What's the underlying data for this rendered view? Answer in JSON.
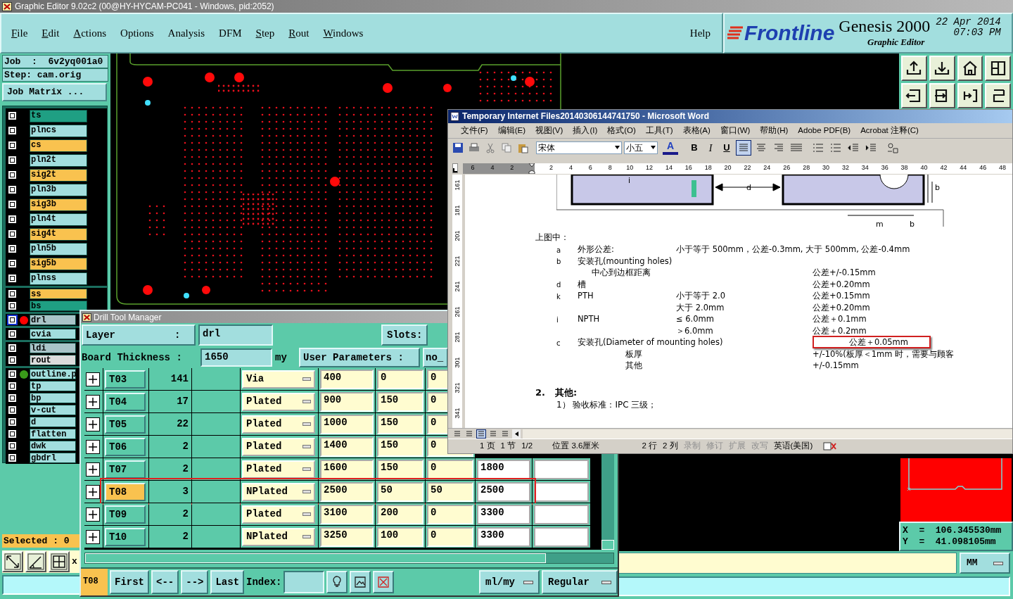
{
  "window": {
    "title": "Graphic Editor 9.02c2 (00@HY-HYCAM-PC041 - Windows, pid:2052)"
  },
  "menu": [
    {
      "label": "File",
      "mnemonic": true
    },
    {
      "label": "Edit",
      "mnemonic": true
    },
    {
      "label": "Actions",
      "mnemonic": true
    },
    {
      "label": "Options",
      "mnemonic": false
    },
    {
      "label": "Analysis",
      "mnemonic": false
    },
    {
      "label": "DFM",
      "mnemonic": false
    },
    {
      "label": "Step",
      "mnemonic": true
    },
    {
      "label": "Rout",
      "mnemonic": true
    },
    {
      "label": "Windows",
      "mnemonic": true
    }
  ],
  "help": "Help",
  "brand": {
    "logo": "Frontline",
    "product": "Genesis 2000",
    "date": "22 Apr 2014",
    "time": "07:03 PM",
    "subtitle": "Graphic Editor"
  },
  "job": {
    "job": "Job  :  6v2yq001a0",
    "step": "Step: cam.orig",
    "matrix_button": "Job Matrix ..."
  },
  "layer_groups": [
    {
      "kind": "spaced",
      "layers": [
        {
          "name": "ts",
          "color": "#1f9f83",
          "active": false
        },
        {
          "name": "plncs",
          "color": "#a2dede",
          "active": false
        },
        {
          "name": "cs",
          "color": "#f9c24f",
          "active": false
        },
        {
          "name": "pln2t",
          "color": "#a2dede",
          "active": false
        },
        {
          "name": "sig2t",
          "color": "#f9c24f",
          "active": false
        },
        {
          "name": "pln3b",
          "color": "#a2dede",
          "active": false
        },
        {
          "name": "sig3b",
          "color": "#f9c24f",
          "active": false
        },
        {
          "name": "pln4t",
          "color": "#a2dede",
          "active": false
        },
        {
          "name": "sig4t",
          "color": "#f9c24f",
          "active": false
        },
        {
          "name": "pln5b",
          "color": "#a2dede",
          "active": false
        },
        {
          "name": "sig5b",
          "color": "#f9c24f",
          "active": false
        },
        {
          "name": "plnss",
          "color": "#a2dede",
          "active": false
        }
      ]
    },
    {
      "kind": "compact",
      "layers": [
        {
          "name": "ss",
          "color": "#f9c24f",
          "active": false
        },
        {
          "name": "bs",
          "color": "#1f9f83",
          "active": false
        }
      ]
    },
    {
      "kind": "compact",
      "layers": [
        {
          "name": "drl",
          "color": "#a9c4c8",
          "active": true,
          "marker": {
            "color": "#ff0000"
          }
        }
      ]
    },
    {
      "kind": "compact",
      "layers": [
        {
          "name": "cvia",
          "color": "#a2dede",
          "active": false
        }
      ]
    },
    {
      "kind": "compact",
      "layers": [
        {
          "name": "ldi",
          "color": "#a9c4c8",
          "active": false
        },
        {
          "name": "rout",
          "color": "#dcdcdc",
          "active": false
        }
      ]
    },
    {
      "kind": "compact",
      "layers": [
        {
          "name": "outline.p",
          "color": "#a2dede",
          "active": false,
          "marker": {
            "color": "#3a9a1a"
          }
        },
        {
          "name": "tp",
          "color": "#a2dede",
          "active": false
        },
        {
          "name": "bp",
          "color": "#a2dede",
          "active": false
        },
        {
          "name": "v-cut",
          "color": "#a2dede",
          "active": false
        },
        {
          "name": "d",
          "color": "#a2dede",
          "active": false
        },
        {
          "name": "flatten",
          "color": "#a2dede",
          "active": false
        },
        {
          "name": "dwk",
          "color": "#a2dede",
          "active": false
        },
        {
          "name": "gbdrl",
          "color": "#a2dede",
          "active": false
        }
      ]
    }
  ],
  "selected_count": "Selected : 0",
  "x_label": "x",
  "coordinates": {
    "x": "X  =  106.345530mm",
    "y": "Y  =  41.098105mm"
  },
  "units": "MM",
  "drill_manager": {
    "title": "Drill Tool Manager",
    "layer_label": "Layer          :",
    "layer": "drl",
    "slots_label": "Slots:",
    "thickness_label": "Board Thickness :",
    "thickness": "1650",
    "thickness_unit": "my",
    "user_params_label": "User Parameters :",
    "user_params": "no_",
    "rows": [
      {
        "tool": "T03",
        "count": "141",
        "type": "Via",
        "finish": "400",
        "plus": "0",
        "minus": "0",
        "selected": false,
        "highlighted": false
      },
      {
        "tool": "T04",
        "count": "17",
        "type": "Plated",
        "finish": "900",
        "plus": "150",
        "minus": "0",
        "selected": false,
        "highlighted": false
      },
      {
        "tool": "T05",
        "count": "22",
        "type": "Plated",
        "finish": "1000",
        "plus": "150",
        "minus": "0",
        "selected": false,
        "highlighted": false
      },
      {
        "tool": "T06",
        "count": "2",
        "type": "Plated",
        "finish": "1400",
        "plus": "150",
        "minus": "0",
        "selected": false,
        "highlighted": false
      },
      {
        "tool": "T07",
        "count": "2",
        "type": "Plated",
        "finish": "1600",
        "plus": "150",
        "minus": "0",
        "drill": "1800",
        "selected": false,
        "highlighted": false
      },
      {
        "tool": "T08",
        "count": "3",
        "type": "NPlated",
        "finish": "2500",
        "plus": "50",
        "minus": "50",
        "drill": "2500",
        "selected": true,
        "highlighted": true
      },
      {
        "tool": "T09",
        "count": "2",
        "type": "Plated",
        "finish": "3100",
        "plus": "200",
        "minus": "0",
        "drill": "3300",
        "selected": false,
        "highlighted": false
      },
      {
        "tool": "T10",
        "count": "2",
        "type": "NPlated",
        "finish": "3250",
        "plus": "100",
        "minus": "0",
        "drill": "3300",
        "selected": false,
        "highlighted": false
      }
    ],
    "current": "T08",
    "nav": [
      "First",
      "<--",
      "-->",
      "Last"
    ],
    "index_label": "Index:",
    "units": "ml/my",
    "mode": "Regular"
  },
  "word": {
    "title": "Temporary Internet Files20140306144741750 - Microsoft Word",
    "menu": [
      "文件(F)",
      "编辑(E)",
      "视图(V)",
      "插入(I)",
      "格式(O)",
      "工具(T)",
      "表格(A)",
      "窗口(W)",
      "帮助(H)",
      "Adobe PDF(B)",
      "Acrobat 注释(C)"
    ],
    "font": "宋体",
    "size": "小五",
    "font_color": "A",
    "bold": "B",
    "italic": "I",
    "underline": "U",
    "ruler": [
      "6",
      "4",
      "2",
      "2",
      "4",
      "6",
      "8",
      "10",
      "12",
      "14",
      "16",
      "18",
      "20",
      "22",
      "24",
      "26",
      "28",
      "30",
      "32",
      "34",
      "36",
      "38",
      "40",
      "42",
      "44",
      "46",
      "48"
    ],
    "vruler": [
      "161",
      "181",
      "201",
      "221",
      "241",
      "261",
      "281",
      "301",
      "321",
      "341"
    ],
    "diagram_labels": [
      "i",
      "d",
      "b",
      "m",
      "b"
    ],
    "heading": "上图中：",
    "lines": [
      {
        "kind": "main",
        "mark": "a",
        "item": "外形公差:",
        "condition": "小于等于 500mm，公差-0.3mm, 大于 500mm, 公差-0.4mm",
        "highlighted": false
      },
      {
        "kind": "main",
        "mark": "b",
        "item": "安装孔(mounting holes)",
        "highlighted": false
      },
      {
        "kind": "sub",
        "item": "中心到边框距离",
        "tolerance": "公差+/-0.15mm",
        "highlighted": false
      },
      {
        "kind": "main",
        "mark": "d",
        "item": "槽",
        "tolerance": "公差+0.20mm",
        "highlighted": false
      },
      {
        "kind": "main",
        "mark": "k",
        "item": "PTH",
        "condition": "小于等于 2.0",
        "tolerance": "公差+0.15mm",
        "highlighted": false
      },
      {
        "kind": "sub",
        "condition": "大于 2.0mm",
        "tolerance": "公差+0.20mm",
        "highlighted": false
      },
      {
        "kind": "main",
        "mark": "i",
        "item": "NPTH",
        "condition": "≤ 6.0mm",
        "tolerance": "公差＋0.1mm",
        "highlighted": false
      },
      {
        "kind": "sub",
        "condition": "＞6.0mm",
        "tolerance": "公差＋0.2mm",
        "highlighted": false
      },
      {
        "kind": "main",
        "mark": "c",
        "item": "安装孔(Diameter of mounting holes)",
        "tolerance": "公差＋0.05mm",
        "highlighted": true
      },
      {
        "kind": "detail",
        "item": "板厚",
        "tolerance": "+/-10%(板厚＜1mm 时，需要与顾客",
        "highlighted": false
      },
      {
        "kind": "detail",
        "item": "其他",
        "tolerance": "+/-0.15mm",
        "highlighted": false
      }
    ],
    "section": {
      "number": "2.",
      "title": "其他:"
    },
    "items": [
      "1） 验收标准：IPC 三级；"
    ],
    "status": [
      {
        "text": "1 页",
        "disabled": false
      },
      {
        "text": "1 节",
        "disabled": false
      },
      {
        "text": "1/2",
        "disabled": false
      },
      {
        "text": "位置 3.6厘米",
        "disabled": false
      },
      {
        "text": "2 行",
        "disabled": false
      },
      {
        "text": "2 列",
        "disabled": false
      },
      {
        "text": "录制",
        "disabled": true
      },
      {
        "text": "修订",
        "disabled": true
      },
      {
        "text": "扩展",
        "disabled": true
      },
      {
        "text": "改写",
        "disabled": true
      },
      {
        "text": "英语(美国)",
        "disabled": false
      }
    ]
  }
}
